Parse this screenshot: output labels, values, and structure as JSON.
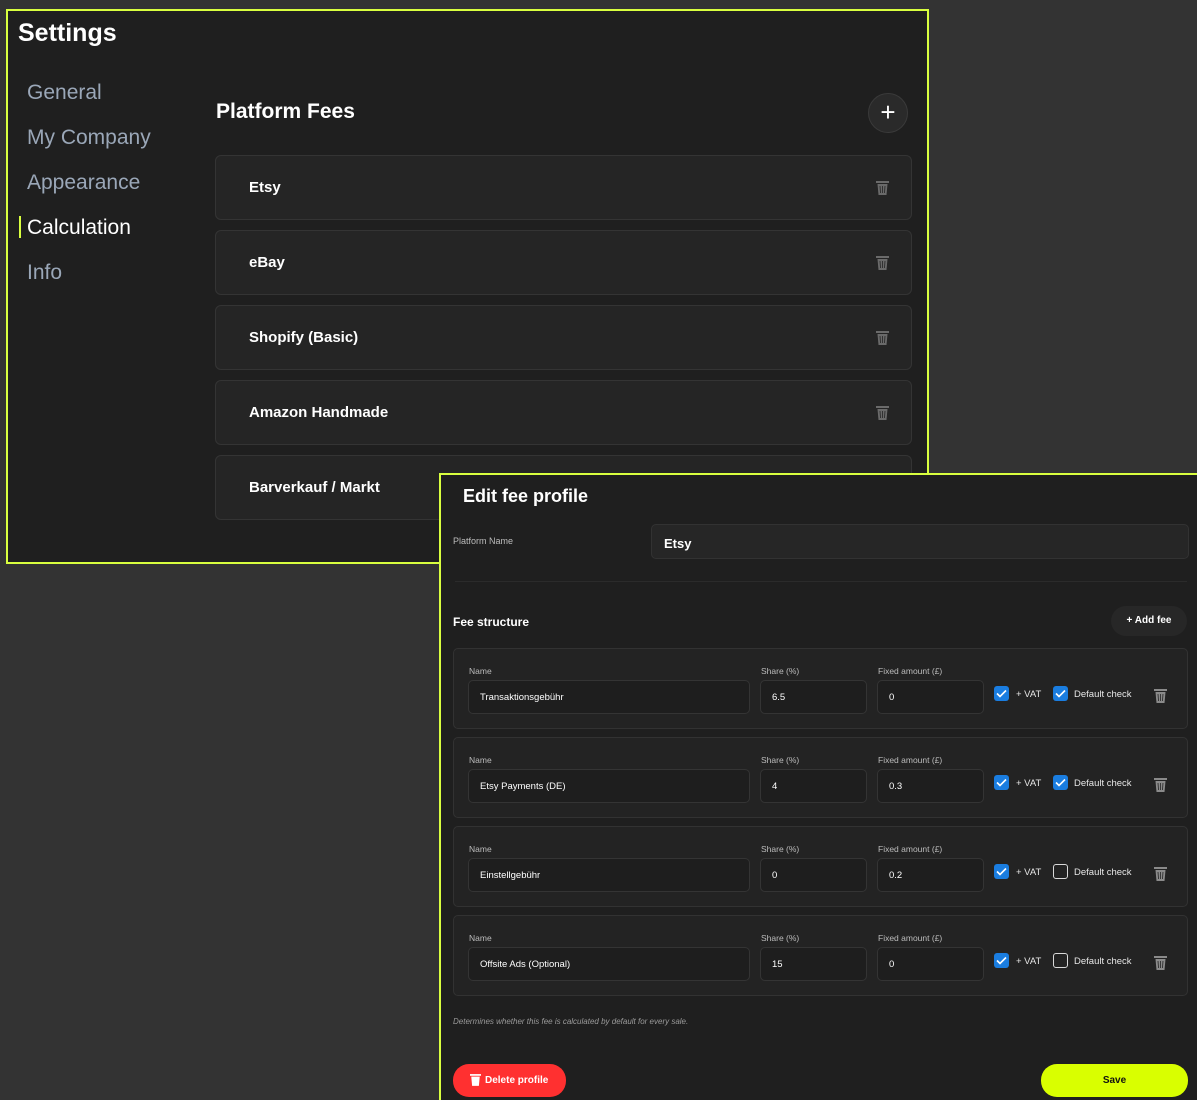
{
  "settings": {
    "title": "Settings",
    "nav": [
      {
        "label": "General",
        "active": false
      },
      {
        "label": "My Company",
        "active": false
      },
      {
        "label": "Appearance",
        "active": false
      },
      {
        "label": "Calculation",
        "active": true
      },
      {
        "label": "Info",
        "active": false
      }
    ],
    "section_title": "Platform Fees",
    "add_icon": "plus-icon",
    "platforms": [
      "Etsy",
      "eBay",
      "Shopify (Basic)",
      "Amazon Handmade",
      "Barverkauf / Markt"
    ]
  },
  "dialog": {
    "title": "Edit fee profile",
    "platform_name_label": "Platform Name",
    "platform_name_value": "Etsy",
    "fee_structure_label": "Fee structure",
    "add_fee_label": "+ Add fee",
    "field_labels": {
      "name": "Name",
      "share": "Share (%)",
      "fixed": "Fixed amount (£)",
      "vat": "+ VAT",
      "default": "Default check"
    },
    "fees": [
      {
        "name": "Transaktionsgebühr",
        "share": "6.5",
        "fixed": "0",
        "vat": true,
        "default": true
      },
      {
        "name": "Etsy Payments (DE)",
        "share": "4",
        "fixed": "0.3",
        "vat": true,
        "default": true
      },
      {
        "name": "Einstellgebühr",
        "share": "0",
        "fixed": "0.2",
        "vat": true,
        "default": false
      },
      {
        "name": "Offsite Ads (Optional)",
        "share": "15",
        "fixed": "0",
        "vat": true,
        "default": false
      }
    ],
    "hint": "Determines whether this fee is calculated by default for every sale.",
    "delete_label": "Delete profile",
    "save_label": "Save"
  },
  "colors": {
    "accent": "#d9ff3f",
    "checkbox": "#1a7de0",
    "danger": "#ff3030",
    "save": "#d9ff00"
  }
}
